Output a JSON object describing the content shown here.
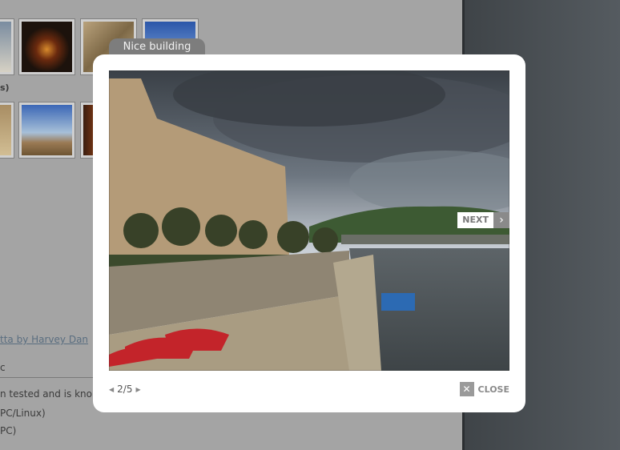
{
  "background": {
    "group_label_fragment": "s)",
    "link_text": "tta by Harvey Dan",
    "heading_fragment": "c",
    "line1": "n tested and is kno",
    "line2": "PC/Linux)",
    "line3": "PC)"
  },
  "lightbox": {
    "caption": "Nice building",
    "next_label": "NEXT",
    "counter": "2/5",
    "close_label": "CLOSE"
  },
  "icons": {
    "next": "chevron-right-icon",
    "prev": "triangle-left-icon",
    "fwd": "triangle-right-icon",
    "close": "close-icon"
  }
}
